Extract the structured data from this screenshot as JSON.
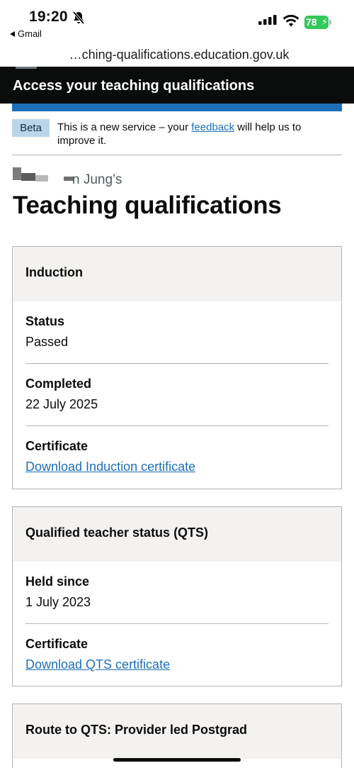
{
  "status_bar": {
    "time": "19:20",
    "back_app": "Gmail",
    "battery": "78"
  },
  "browser": {
    "url": "…ching-qualifications.education.gov.uk"
  },
  "header": {
    "service_name": "Access your teaching qualifications",
    "accent_color": "#1d70b8"
  },
  "phase_banner": {
    "tag": "Beta",
    "text_before": "This is a new service – your ",
    "link": "feedback",
    "text_after": " will help us to improve it."
  },
  "caption": "n Jung’s",
  "title": "Teaching qualifications",
  "cards": [
    {
      "title": "Induction",
      "rows": [
        {
          "key": "Status",
          "value": "Passed"
        },
        {
          "key": "Completed",
          "value": "22 July 2025"
        },
        {
          "key": "Certificate",
          "link": "Download Induction certificate"
        }
      ]
    },
    {
      "title": "Qualified teacher status (QTS)",
      "rows": [
        {
          "key": "Held since",
          "value": "1 July 2023"
        },
        {
          "key": "Certificate",
          "link": "Download QTS certificate"
        }
      ]
    },
    {
      "title": "Route to QTS: Provider led Postgrad"
    }
  ]
}
